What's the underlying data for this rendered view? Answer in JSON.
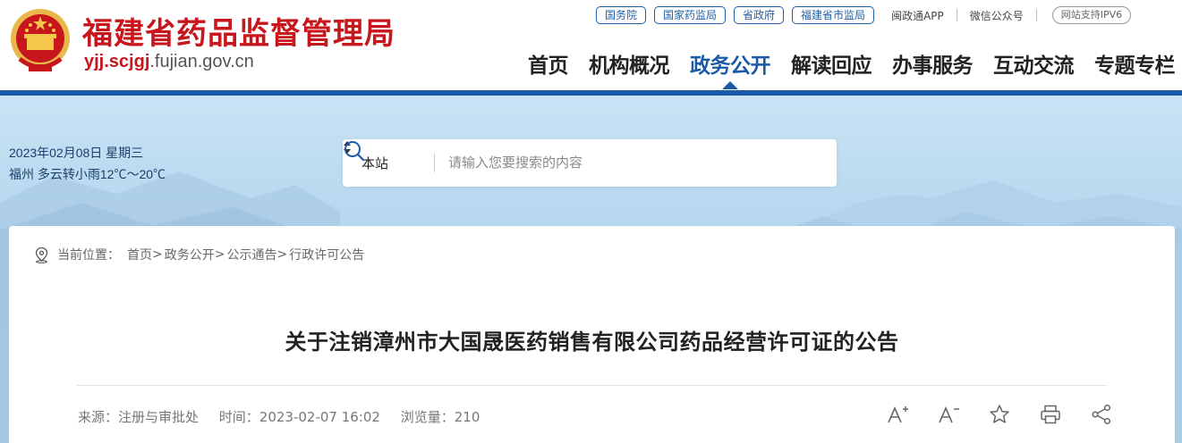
{
  "header": {
    "site_name": "福建省药品监督管理局",
    "domain_prefix": "yjj.scjgj",
    "domain_rest": ".fujian.gov.cn",
    "top_links": [
      "国务院",
      "国家药监局",
      "省政府",
      "福建省市监局"
    ],
    "app_link": "闽政通APP",
    "wechat_link": "微信公众号",
    "ipv6_badge": "网站支持IPV6",
    "nav": [
      "首页",
      "机构概况",
      "政务公开",
      "解读回应",
      "办事服务",
      "互动交流",
      "专题专栏"
    ],
    "active_nav": "政务公开"
  },
  "banner": {
    "date_line": "2023年02月08日 星期三",
    "weather_line": "福州 多云转小雨12℃～20℃",
    "search": {
      "scope": "本站",
      "placeholder": "请输入您要搜索的内容"
    }
  },
  "breadcrumb": {
    "prefix": "当前位置：",
    "items": [
      "首页",
      "政务公开",
      "公示通告",
      "行政许可公告"
    ],
    "separator": ">"
  },
  "article": {
    "title": "关于注销漳州市大国晟医药销售有限公司药品经营许可证的公告",
    "source": "来源：注册与审批处",
    "time": "时间：2023-02-07 16:02",
    "views": "浏览量：210"
  },
  "tools": [
    "font-increase-icon",
    "font-decrease-icon",
    "star-icon",
    "print-icon",
    "share-icon"
  ],
  "colors": {
    "brand_red": "#c8161d",
    "nav_blue": "#1b5aa7",
    "pill_blue": "#1f5fa8"
  }
}
